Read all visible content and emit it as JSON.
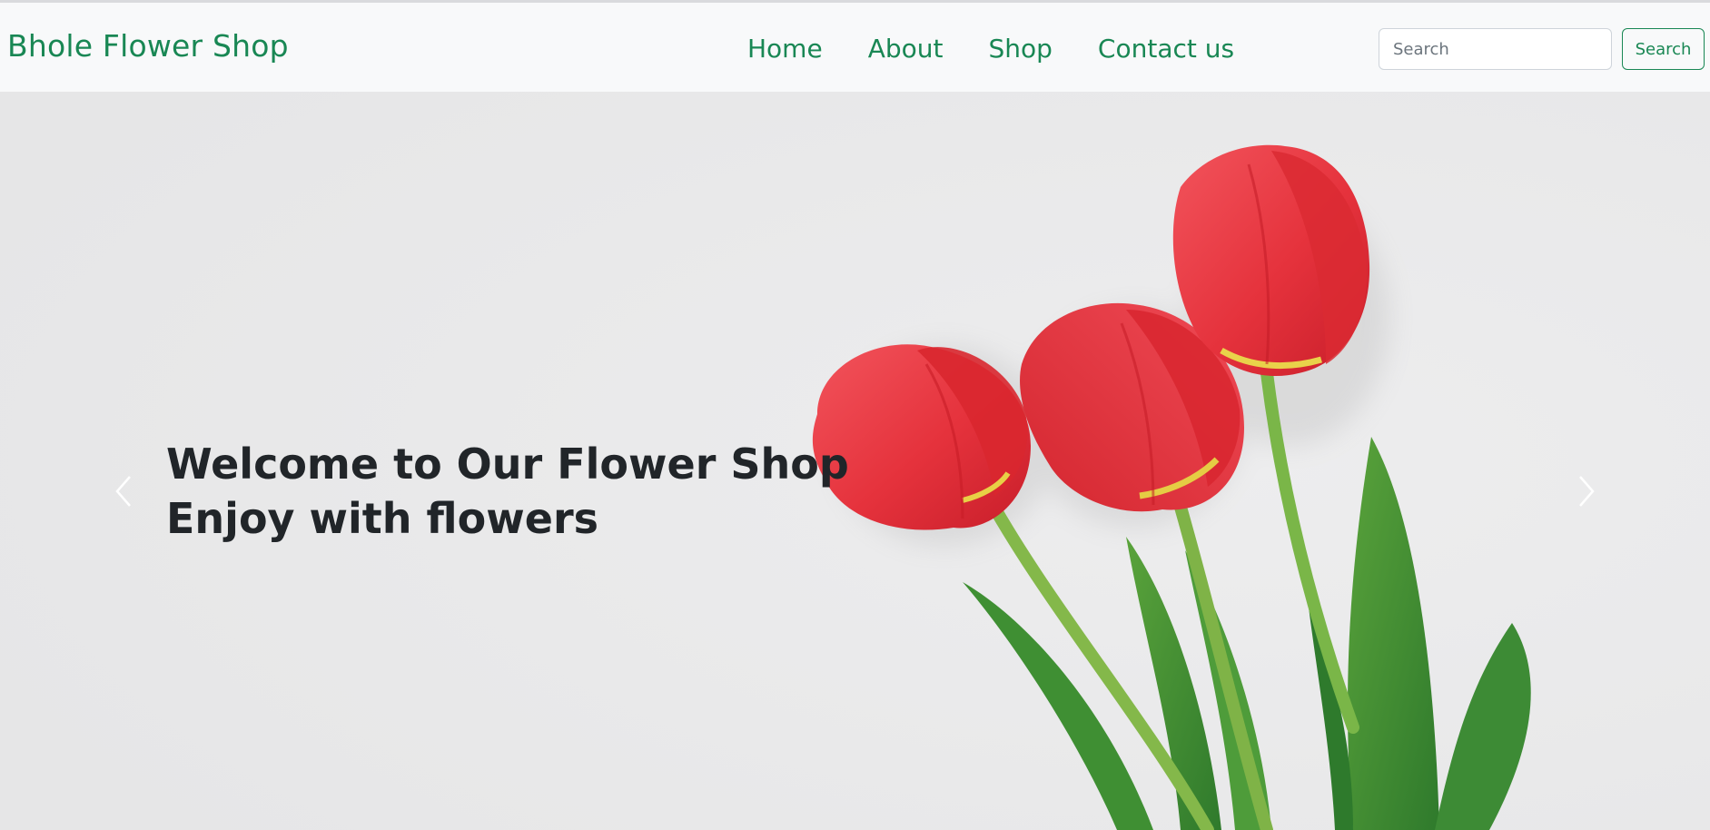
{
  "navbar": {
    "brand": "Bhole Flower Shop",
    "links": [
      "Home",
      "About",
      "Shop",
      "Contact us"
    ],
    "search": {
      "placeholder": "Search",
      "value": "",
      "button_label": "Search"
    }
  },
  "carousel": {
    "caption_line1": "Welcome to Our Flower Shop",
    "caption_line2": "Enjoy with flowers",
    "prev_icon": "chevron-left-icon",
    "next_icon": "chevron-right-icon"
  },
  "colors": {
    "brand": "#198754",
    "navbar_bg": "#f8f9fa",
    "hero_bg": "#e8e8e9",
    "tulip_red": "#e8343f",
    "stem_green": "#7ab648",
    "caption_text": "#212529"
  }
}
